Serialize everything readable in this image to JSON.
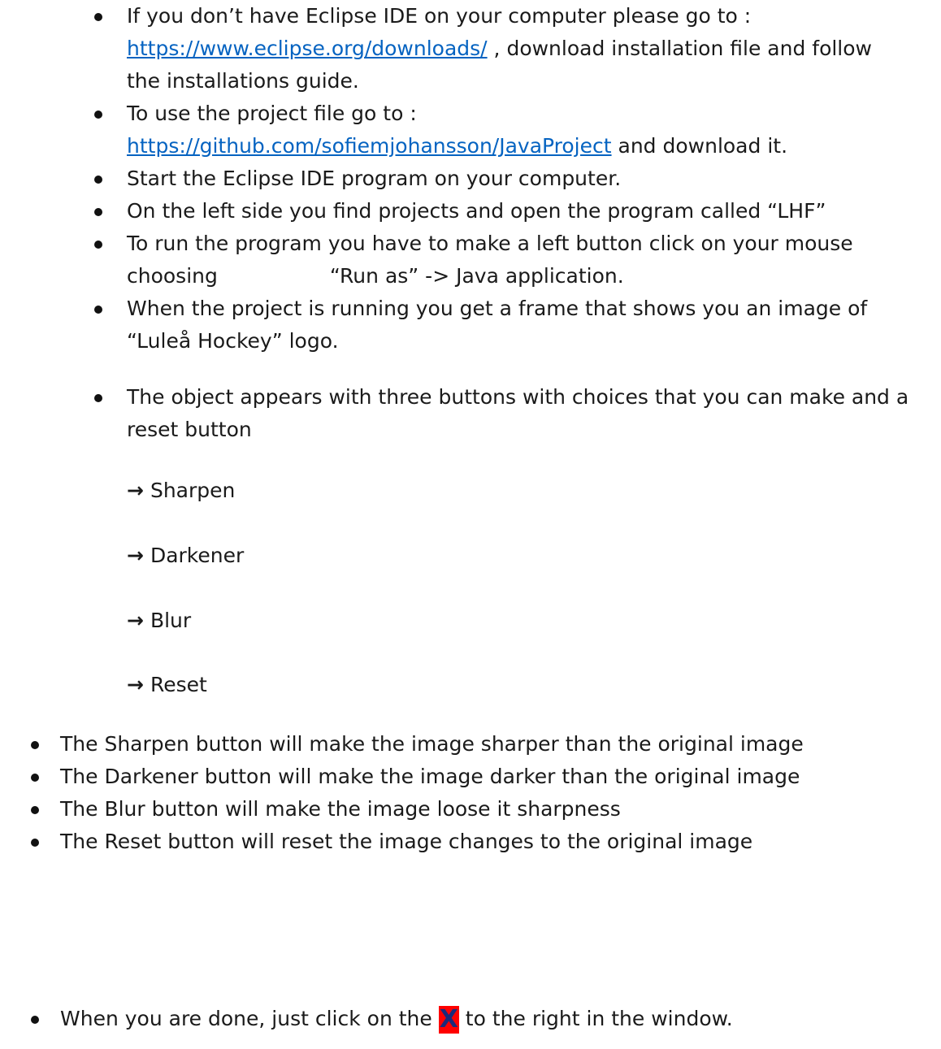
{
  "colors": {
    "link": "#0563c1",
    "text": "#1a1a1a",
    "highlight": "#ff0000",
    "x_text": "#1b2a7a"
  },
  "steps": {
    "s1": {
      "before": "If you don’t have Eclipse IDE on your computer please go to :",
      "link": "https://www.eclipse.org/downloads/",
      "after": " , download installation file and follow",
      "cont": "the installations guide."
    },
    "s2": {
      "before": "To use the project file go to :",
      "link": "https://github.com/sofiemjohansson/JavaProject",
      "after": " and download it."
    },
    "s3": {
      "text": "Start the Eclipse IDE program on your computer."
    },
    "s4": {
      "text": "On the left side you find projects and open the program called “LHF”"
    },
    "s5": {
      "line1": "To run the program you have to make a left button click on your mouse",
      "choosing": "choosing",
      "run_as": "“Run as” -> Java application."
    },
    "s6": {
      "line1": "When the project is running you get a frame that shows you an image of",
      "line2": "“Luleå Hockey” logo."
    },
    "s7": {
      "line1": "The object appears with three buttons with choices that you can make and a",
      "line2": "reset button"
    }
  },
  "choices": [
    {
      "arrow": "→",
      "label": "Sharpen"
    },
    {
      "arrow": "→",
      "label": "Darkener"
    },
    {
      "arrow": "→",
      "label": "Blur"
    },
    {
      "arrow": "→",
      "label": "Reset"
    }
  ],
  "descriptions": [
    "The Sharpen button will make the image sharper than the original image",
    "The Darkener button will make the image darker than the original image",
    "The Blur button will make the image loose it sharpness",
    "The Reset button will reset the image changes  to the original image"
  ],
  "final": {
    "before": "When you are done, just click on the ",
    "x": "X",
    "after": " to the right in the window."
  }
}
